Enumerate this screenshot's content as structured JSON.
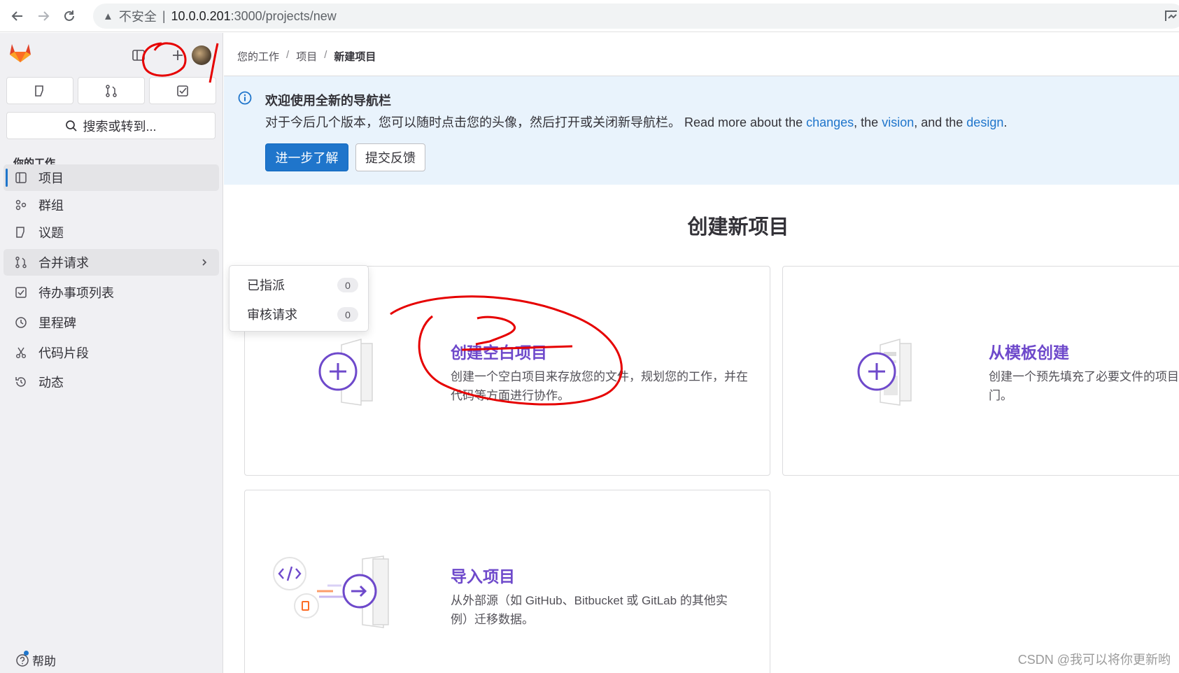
{
  "browser": {
    "security_label": "不安全",
    "url_host": "10.0.0.201",
    "url_path": ":3000/projects/new"
  },
  "sidebar": {
    "search_label": "搜索或转到...",
    "section_title": "你的工作",
    "items": [
      {
        "label": "项目",
        "icon": "project-icon"
      },
      {
        "label": "群组",
        "icon": "group-icon"
      },
      {
        "label": "议题",
        "icon": "issues-icon"
      },
      {
        "label": "合并请求",
        "icon": "merge-request-icon"
      },
      {
        "label": "待办事项列表",
        "icon": "todo-icon"
      },
      {
        "label": "里程碑",
        "icon": "clock-icon"
      },
      {
        "label": "代码片段",
        "icon": "snippet-icon"
      },
      {
        "label": "动态",
        "icon": "history-icon"
      }
    ],
    "help_label": "帮助"
  },
  "flyout": {
    "items": [
      {
        "label": "已指派",
        "count": "0"
      },
      {
        "label": "审核请求",
        "count": "0"
      }
    ]
  },
  "breadcrumb": {
    "items": [
      "您的工作",
      "项目",
      "新建项目"
    ]
  },
  "banner": {
    "title": "欢迎使用全新的导航栏",
    "body_text": "对于今后几个版本，您可以随时点击您的头像，然后打开或关闭新导航栏。 Read more about the ",
    "link_changes": "changes",
    "text_the": ", the ",
    "link_vision": "vision",
    "text_and_the": ", and the ",
    "link_design": "design",
    "text_period": ".",
    "learn_more_button": "进一步了解",
    "feedback_button": "提交反馈"
  },
  "main": {
    "page_title": "创建新项目",
    "cards": [
      {
        "title": "创建空白项目",
        "desc_line1": "创建一个空白项目来存放您的文件，规划您的工作，并在",
        "desc_line2": "代码等方面进行协作。"
      },
      {
        "title": "从模板创建",
        "desc_line1": "创建一个预先填充了必要文件的项目",
        "desc_line2": "门。"
      },
      {
        "title": "导入项目",
        "desc_line1": "从外部源（如 GitHub、Bitbucket 或 GitLab 的其他实",
        "desc_line2": "例）迁移数据。"
      }
    ]
  },
  "watermark": "CSDN @我可以将你更新哟",
  "colors": {
    "accent": "#1f75cb",
    "card_title": "#6e49cb",
    "banner_bg": "#e9f3fc",
    "annotation": "#e60000"
  }
}
